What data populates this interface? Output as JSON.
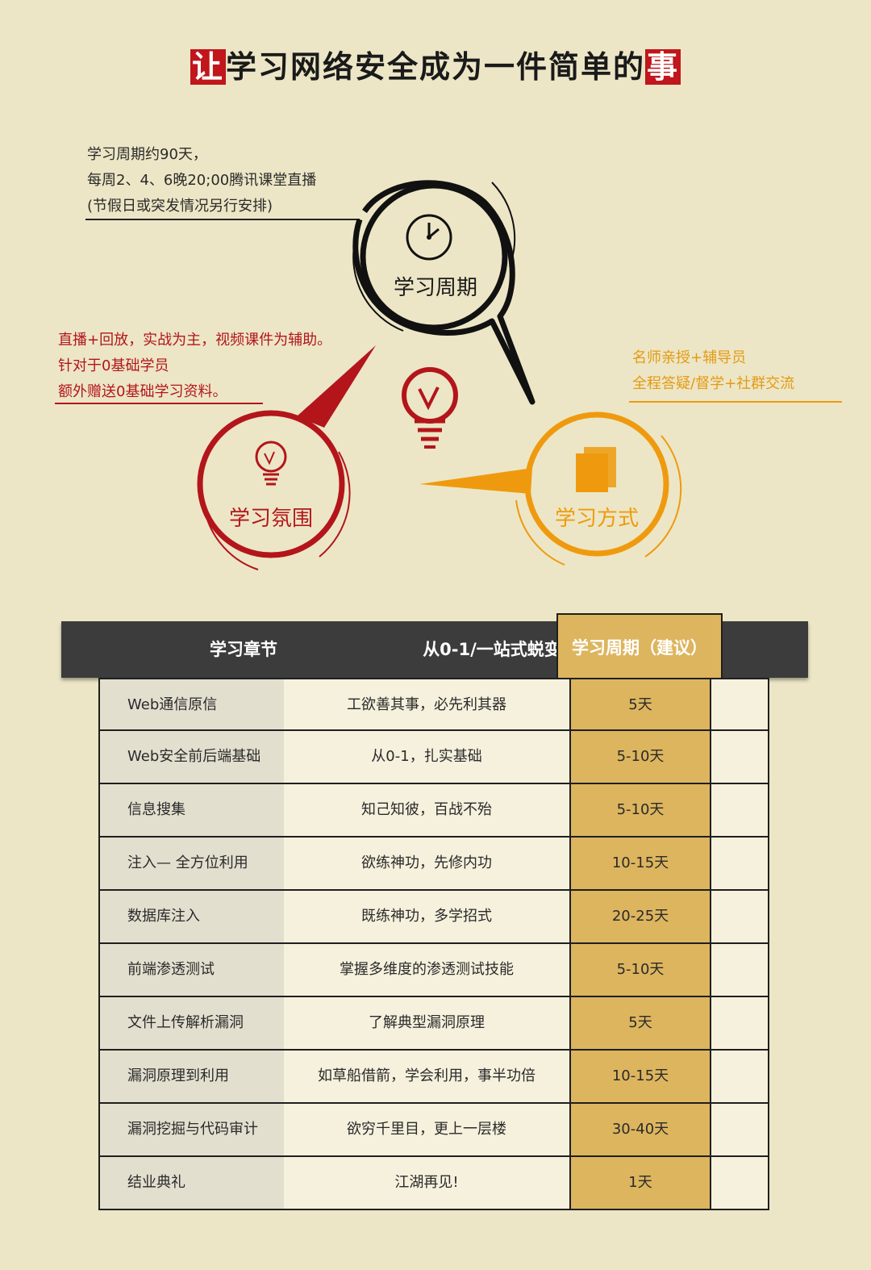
{
  "title": {
    "first_char": "让",
    "middle": "学习网络安全成为一件简单的",
    "last_char": "事"
  },
  "notes": {
    "cycle": [
      "学习周期约90天，",
      "每周2、4、6晚20;00腾讯课堂直播",
      "(节假日或突发情况另行安排)"
    ],
    "atmosphere": [
      "直播+回放，实战为主，视频课件为辅助。",
      "针对于0基础学员",
      "额外赠送0基础学习资料。"
    ],
    "method": [
      "名师亲授+辅导员",
      "全程答疑/督学+社群交流"
    ]
  },
  "circles": {
    "cycle": "学习周期",
    "atmosphere": "学习氛围",
    "method": "学习方式"
  },
  "icons": {
    "cycle": "clock-icon",
    "atmosphere": "lightbulb-icon",
    "center": "lightbulb-icon",
    "method": "document-icon"
  },
  "colors": {
    "background": "#ece6c6",
    "red": "#b3151b",
    "orange": "#ef9a0e",
    "dark": "#1a1a1a",
    "header": "#3c3c3c",
    "gold": "#ddb55e"
  },
  "table": {
    "headers": [
      "学习章节",
      "从0-1/一站式蜕变",
      "学习周期（建议）"
    ],
    "rows": [
      [
        "Web通信原信",
        "工欲善其事，必先利其器",
        "5天"
      ],
      [
        "Web安全前后端基础",
        "从0-1，扎实基础",
        "5-10天"
      ],
      [
        "信息搜集",
        "知己知彼，百战不殆",
        "5-10天"
      ],
      [
        "注入— 全方位利用",
        "欲练神功，先修内功",
        "10-15天"
      ],
      [
        "数据库注入",
        "既练神功，多学招式",
        "20-25天"
      ],
      [
        "前端渗透测试",
        "掌握多维度的渗透测试技能",
        "5-10天"
      ],
      [
        "文件上传解析漏洞",
        "了解典型漏洞原理",
        "5天"
      ],
      [
        "漏洞原理到利用",
        "如草船借箭，学会利用，事半功倍",
        "10-15天"
      ],
      [
        "漏洞挖掘与代码审计",
        "欲穷千里目，更上一层楼",
        "30-40天"
      ],
      [
        "结业典礼",
        "江湖再见!",
        "1天"
      ]
    ]
  }
}
